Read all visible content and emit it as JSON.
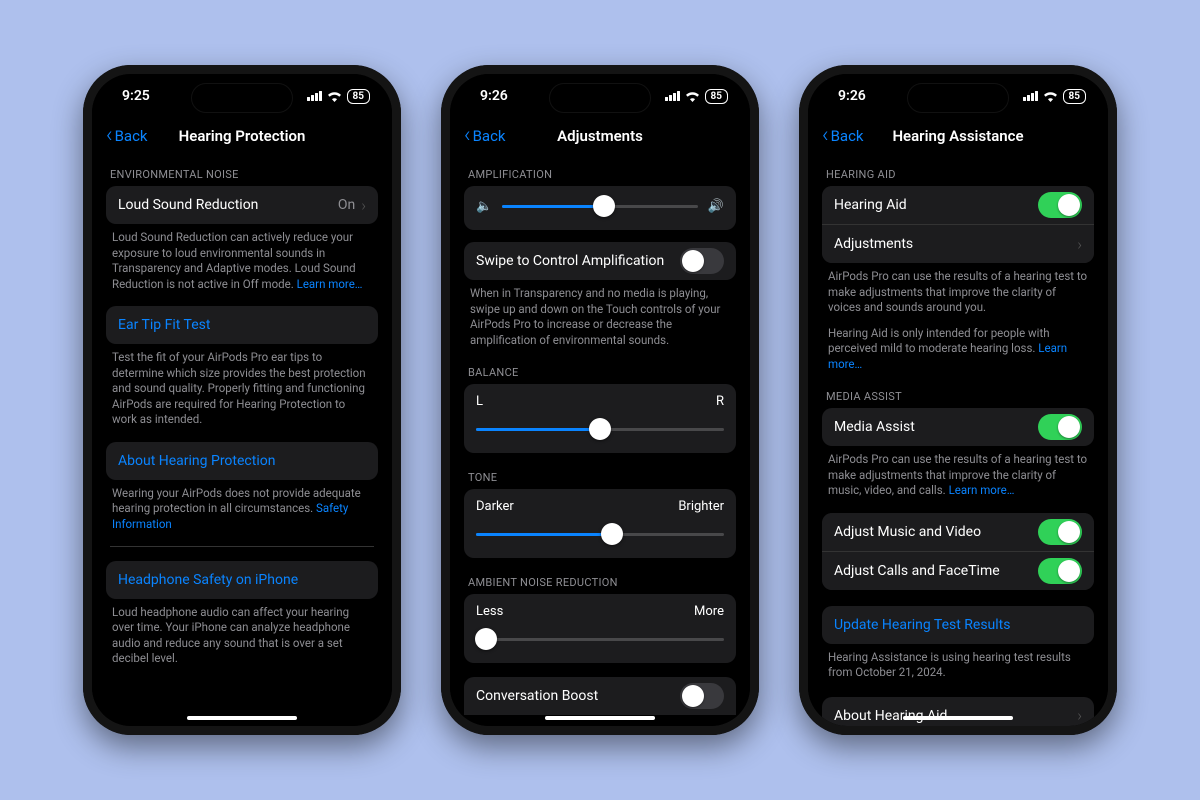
{
  "colors": {
    "accent": "#0a84ff",
    "green": "#30d158",
    "bg": "#000",
    "cell": "#1c1c1e",
    "secondary": "#8e8e93"
  },
  "phone1": {
    "time": "9:25",
    "battery": "85",
    "back": "Back",
    "title": "Hearing Protection",
    "sec1_header": "ENVIRONMENTAL NOISE",
    "loud_label": "Loud Sound Reduction",
    "loud_value": "On",
    "loud_footer": "Loud Sound Reduction can actively reduce your exposure to loud environmental sounds in Transparency and Adaptive modes. Loud Sound Reduction is not active in Off mode. ",
    "loud_footer_link": "Learn more…",
    "eartip_label": "Ear Tip Fit Test",
    "eartip_footer": "Test the fit of your AirPods Pro ear tips to determine which size provides the best protection and sound quality. Properly fitting and functioning AirPods are required for Hearing Protection to work as intended.",
    "about_label": "About Hearing Protection",
    "about_footer": "Wearing your AirPods does not provide adequate hearing protection in all circumstances. ",
    "about_link": "Safety Information",
    "hp_safety_label": "Headphone Safety on iPhone",
    "hp_safety_footer": "Loud headphone audio can affect your hearing over time. Your iPhone can analyze headphone audio and reduce any sound that is over a set decibel level."
  },
  "phone2": {
    "time": "9:26",
    "battery": "85",
    "back": "Back",
    "title": "Adjustments",
    "amp_header": "AMPLIFICATION",
    "amp_value": 52,
    "swipe_label": "Swipe to Control Amplification",
    "swipe_on": false,
    "swipe_footer": "When in Transparency and no media is playing, swipe up and down on the Touch controls of your AirPods Pro to increase or decrease the amplification of environmental sounds.",
    "bal_header": "BALANCE",
    "bal_left": "L",
    "bal_right": "R",
    "bal_value": 50,
    "tone_header": "TONE",
    "tone_left": "Darker",
    "tone_right": "Brighter",
    "tone_value": 55,
    "anr_header": "AMBIENT NOISE REDUCTION",
    "anr_left": "Less",
    "anr_right": "More",
    "anr_value": 4,
    "conv_label": "Conversation Boost",
    "conv_on": false
  },
  "phone3": {
    "time": "9:26",
    "battery": "85",
    "back": "Back",
    "title": "Hearing Assistance",
    "ha_header": "HEARING AID",
    "ha_label": "Hearing Aid",
    "ha_on": true,
    "adj_label": "Adjustments",
    "ha_footer1": "AirPods Pro can use the results of a hearing test to make adjustments that improve the clarity of voices and sounds around you.",
    "ha_footer2": "Hearing Aid is only intended for people with perceived mild to moderate hearing loss. ",
    "ha_footer2_link": "Learn more…",
    "ma_header": "MEDIA ASSIST",
    "ma_label": "Media Assist",
    "ma_on": true,
    "ma_footer": "AirPods Pro can use the results of a hearing test to make adjustments that improve the clarity of music, video, and calls. ",
    "ma_link": "Learn more…",
    "adj_music": "Adjust Music and Video",
    "adj_music_on": true,
    "adj_calls": "Adjust Calls and FaceTime",
    "adj_calls_on": true,
    "update_label": "Update Hearing Test Results",
    "update_footer": "Hearing Assistance is using hearing test results from October 21, 2024.",
    "about_label": "About Hearing Aid"
  }
}
